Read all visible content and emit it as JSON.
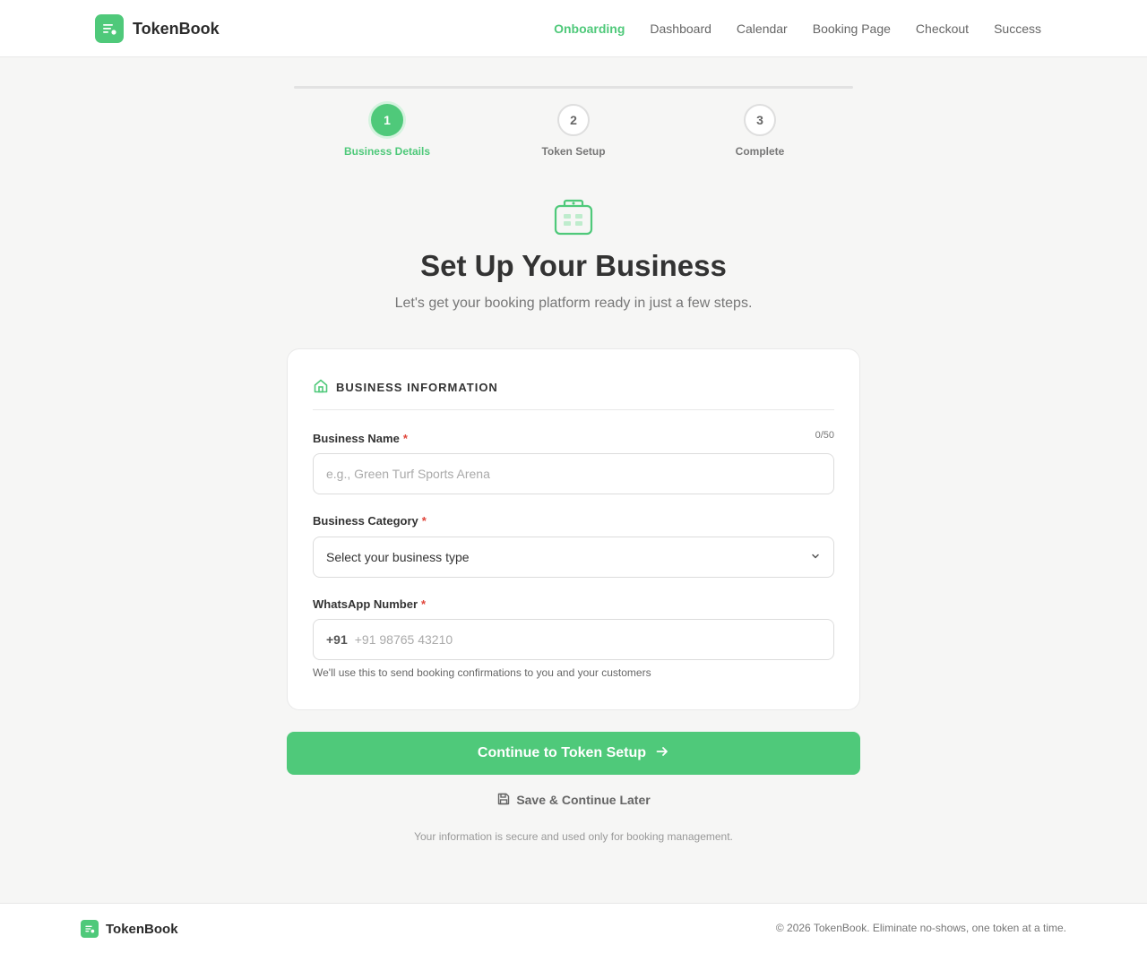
{
  "app": {
    "name": "TokenBook"
  },
  "nav": {
    "items": [
      {
        "label": "Onboarding",
        "active": true
      },
      {
        "label": "Dashboard",
        "active": false
      },
      {
        "label": "Calendar",
        "active": false
      },
      {
        "label": "Booking Page",
        "active": false
      },
      {
        "label": "Checkout",
        "active": false
      },
      {
        "label": "Success",
        "active": false
      }
    ]
  },
  "stepper": {
    "steps": [
      {
        "number": "1",
        "label": "Business Details",
        "state": "active"
      },
      {
        "number": "2",
        "label": "Token Setup",
        "state": "pending"
      },
      {
        "number": "3",
        "label": "Complete",
        "state": "pending"
      }
    ]
  },
  "hero": {
    "icon": "calendar-store-icon",
    "title": "Set Up Your Business",
    "subtitle": "Let's get your booking platform ready in just a few steps."
  },
  "form": {
    "section_title": "BUSINESS INFORMATION",
    "section_icon": "home-icon",
    "business_name": {
      "label": "Business Name",
      "required_mark": "*",
      "counter": "0/50",
      "value": "",
      "placeholder": "e.g., Green Turf Sports Arena"
    },
    "business_category": {
      "label": "Business Category",
      "required_mark": "*",
      "selected": "Select your business type"
    },
    "whatsapp": {
      "label": "WhatsApp Number",
      "required_mark": "*",
      "prefix": "+91",
      "value": "",
      "placeholder": "+91 98765 43210",
      "hint": "We'll use this to send booking confirmations to you and your customers"
    }
  },
  "actions": {
    "continue_label": "Continue to Token Setup",
    "save_label": "Save & Continue Later",
    "secure_note": "Your information is secure and used only for booking management."
  },
  "footer": {
    "brand": "TokenBook",
    "copyright": "© 2026 TokenBook. Eliminate no-shows, one token at a time."
  },
  "colors": {
    "accent": "#4fc97a",
    "required": "#e0453a",
    "background": "#f6f6f5"
  }
}
